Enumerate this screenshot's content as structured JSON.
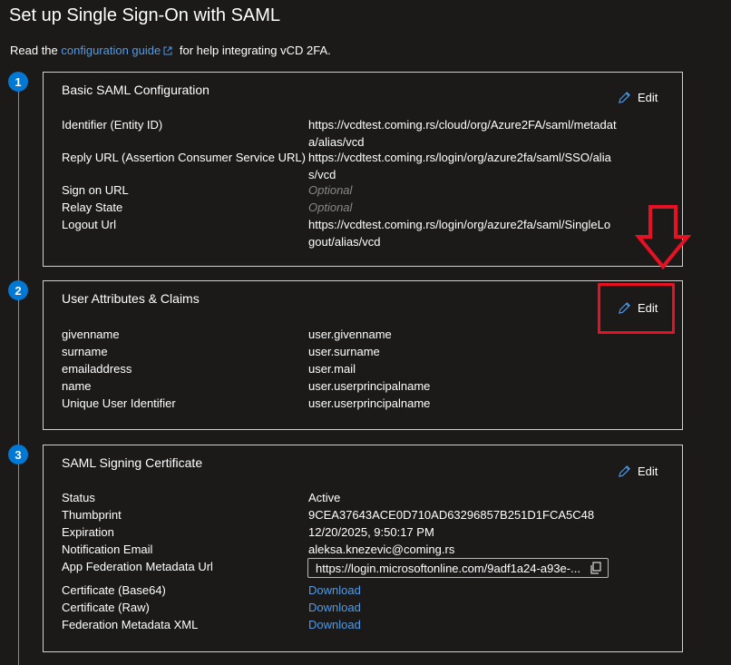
{
  "title": "Set up Single Sign-On with SAML",
  "intro": {
    "prefix": "Read the ",
    "link": "configuration guide",
    "suffix": " for help integrating vCD 2FA."
  },
  "edit_label": "Edit",
  "sections": {
    "basic": {
      "step": "1",
      "title": "Basic SAML Configuration",
      "rows": [
        {
          "label": "Identifier (Entity ID)",
          "value": "https://vcdtest.coming.rs/cloud/org/Azure2FA/saml/metadata/alias/vcd"
        },
        {
          "label": "Reply URL (Assertion Consumer Service URL)",
          "value": "https://vcdtest.coming.rs/login/org/azure2fa/saml/SSO/alias/vcd"
        },
        {
          "label": "Sign on URL",
          "value": "Optional"
        },
        {
          "label": "Relay State",
          "value": "Optional"
        },
        {
          "label": "Logout Url",
          "value": "https://vcdtest.coming.rs/login/org/azure2fa/saml/SingleLogout/alias/vcd"
        }
      ]
    },
    "claims": {
      "step": "2",
      "title": "User Attributes & Claims",
      "rows": [
        {
          "label": "givenname",
          "value": "user.givenname"
        },
        {
          "label": "surname",
          "value": "user.surname"
        },
        {
          "label": "emailaddress",
          "value": "user.mail"
        },
        {
          "label": "name",
          "value": "user.userprincipalname"
        },
        {
          "label": "Unique User Identifier",
          "value": "user.userprincipalname"
        }
      ]
    },
    "cert": {
      "step": "3",
      "title": "SAML Signing Certificate",
      "rows": [
        {
          "label": "Status",
          "value": "Active"
        },
        {
          "label": "Thumbprint",
          "value": "9CEA37643ACE0D710AD63296857B251D1FCA5C48"
        },
        {
          "label": "Expiration",
          "value": "12/20/2025, 9:50:17 PM"
        },
        {
          "label": "Notification Email",
          "value": "aleksa.knezevic@coming.rs"
        },
        {
          "label": "App Federation Metadata Url",
          "value": "https://login.microsoftonline.com/9adf1a24-a93e-..."
        },
        {
          "label": "Certificate (Base64)",
          "value": "Download"
        },
        {
          "label": "Certificate (Raw)",
          "value": "Download"
        },
        {
          "label": "Federation Metadata XML",
          "value": "Download"
        }
      ]
    }
  },
  "colors": {
    "accent": "#0078d4",
    "link": "#4f9be8",
    "highlight": "#e81123"
  }
}
